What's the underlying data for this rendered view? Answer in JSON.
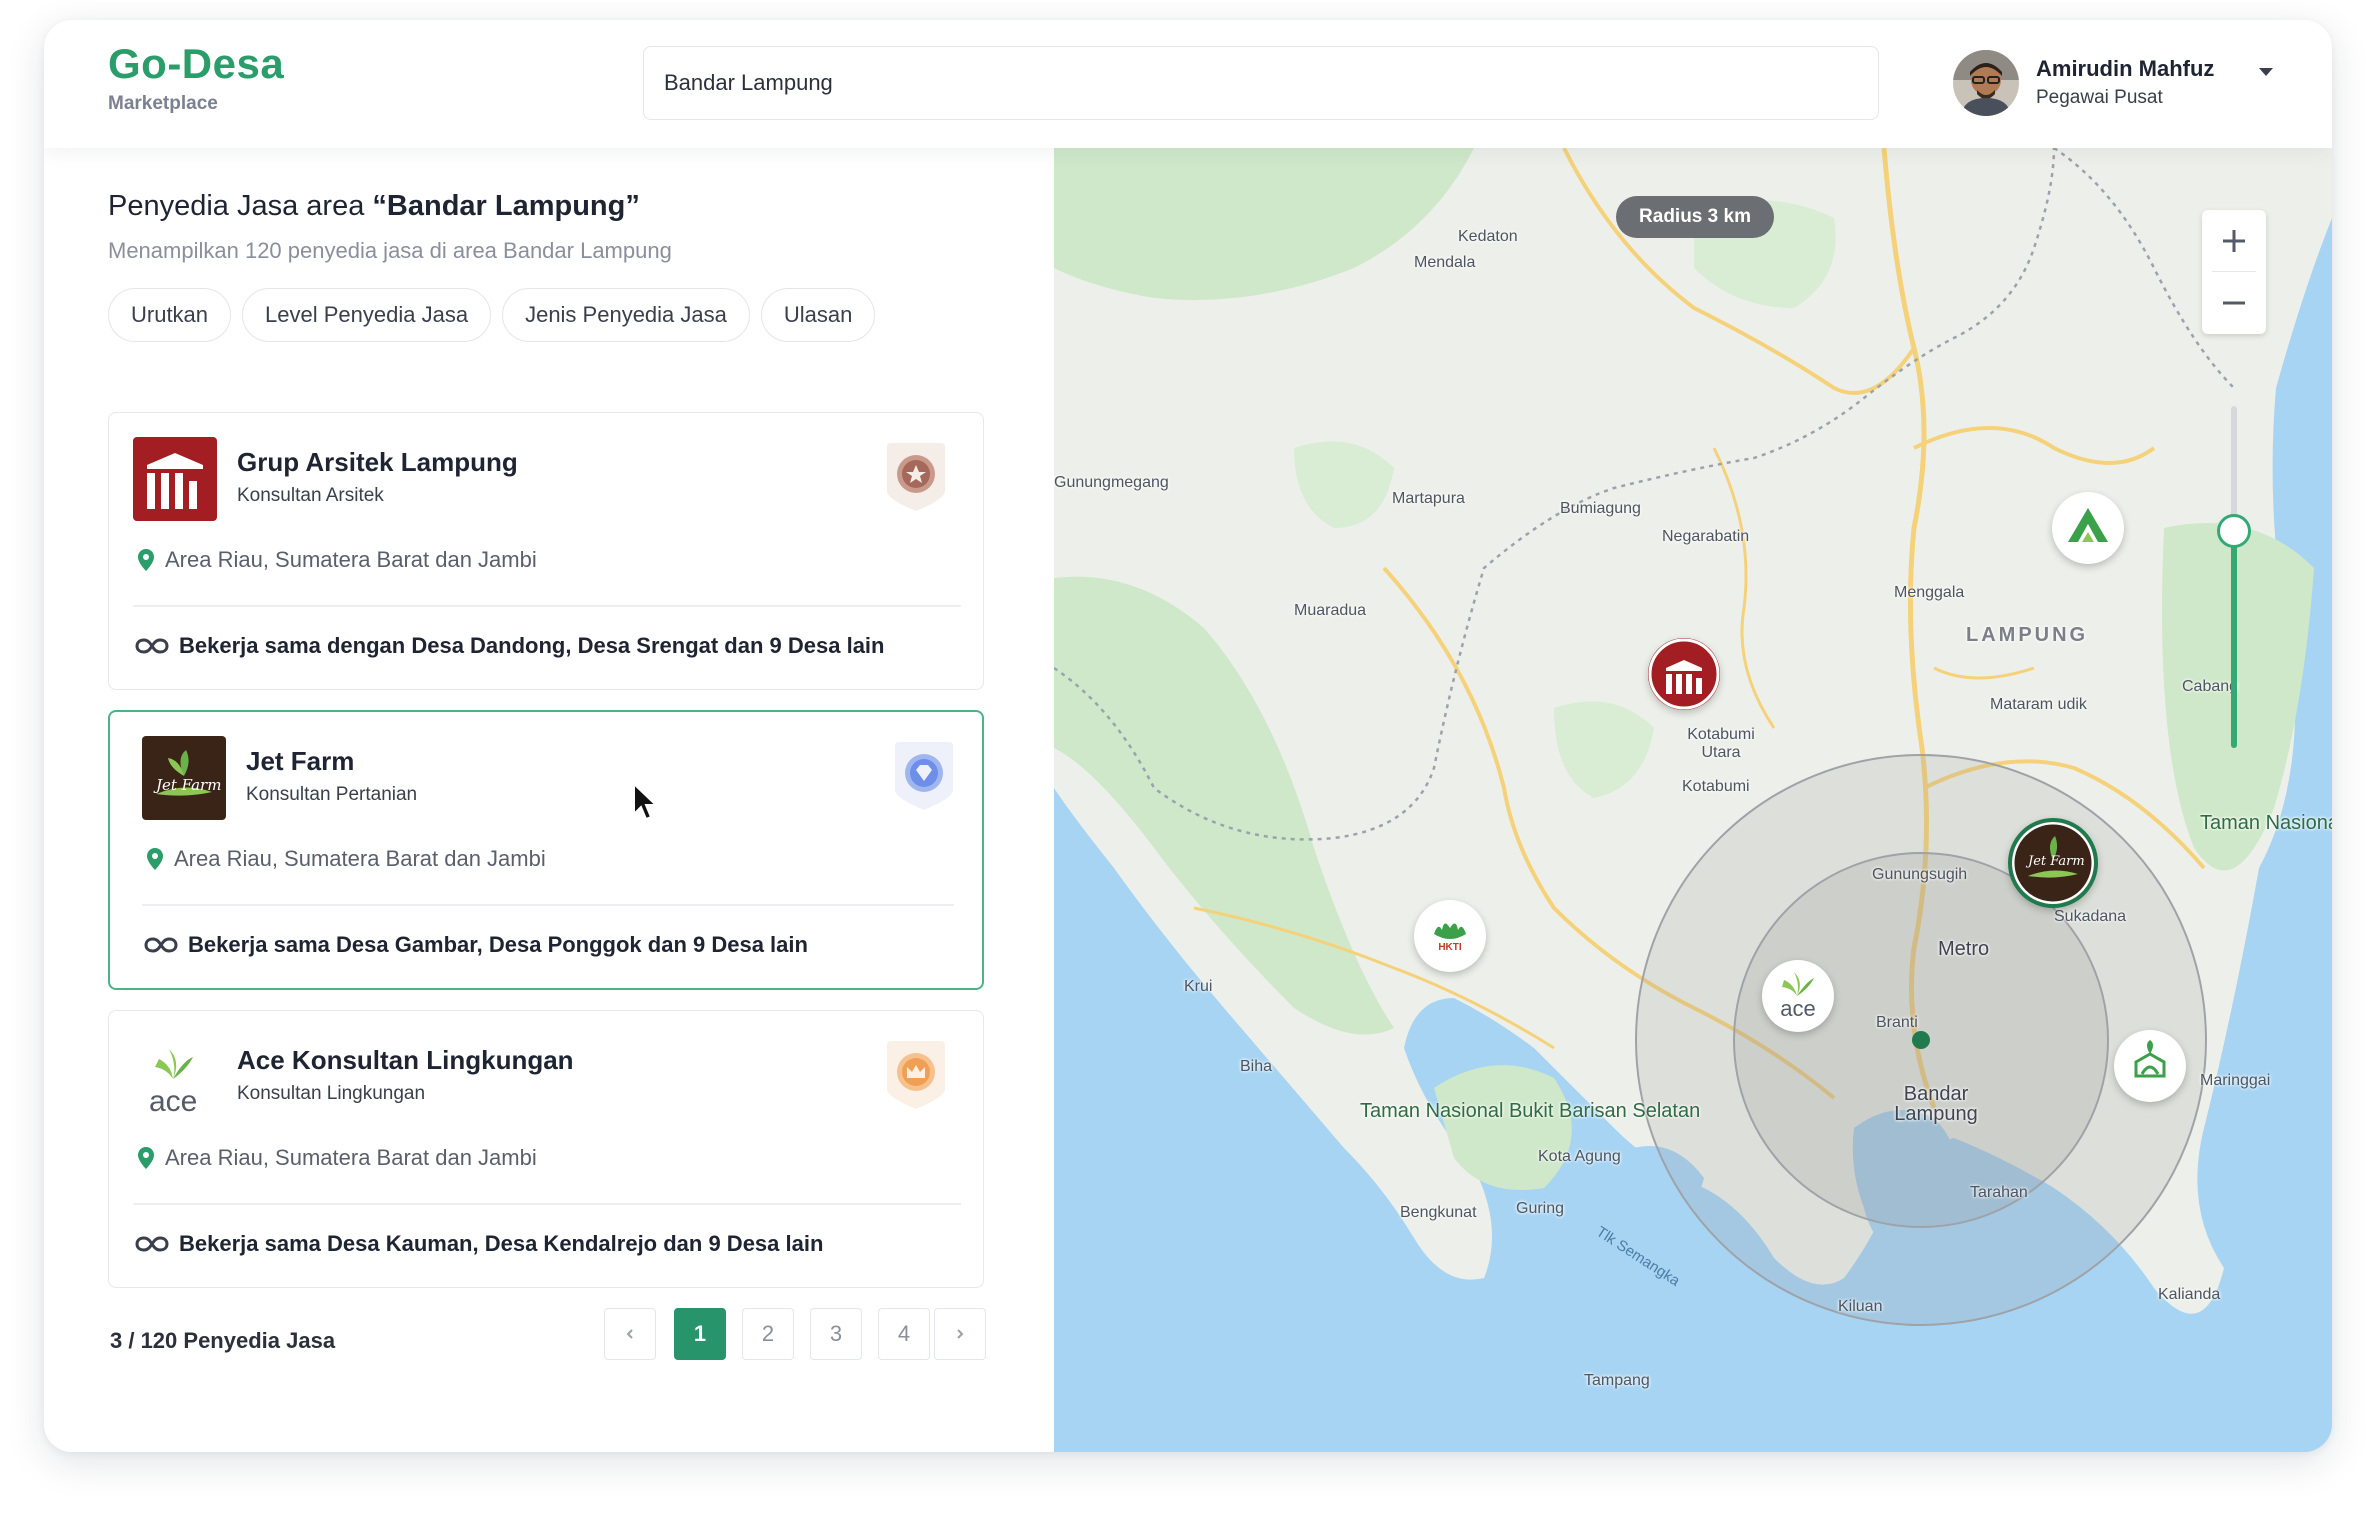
{
  "header": {
    "brand_title": "Go-Desa",
    "brand_subtitle": "Marketplace",
    "search_value": "Bandar Lampung",
    "user_name": "Amirudin Mahfuz",
    "user_role": "Pegawai Pusat",
    "avatar_icon": "user-photo-avatar",
    "caret_icon": "caret-down-icon"
  },
  "listing": {
    "title_prefix": "Penyedia Jasa area ",
    "title_area": "“Bandar Lampung”",
    "subtitle": "Menampilkan 120 penyedia jasa di area Bandar Lampung",
    "filters": [
      "Urutkan",
      "Level Penyedia Jasa",
      "Jenis Penyedia Jasa",
      "Ulasan"
    ]
  },
  "providers": [
    {
      "name": "Grup Arsitek Lampung",
      "type": "Konsultan Arsitek",
      "location": "Area Riau, Sumatera Barat dan Jambi",
      "collab": "Bekerja sama dengan Desa Dandong, Desa Srengat dan 9 Desa lain",
      "badge": "bronze-star-badge",
      "badge_color": "#a5685a"
    },
    {
      "name": "Jet Farm",
      "type": "Konsultan Pertanian",
      "location": "Area Riau, Sumatera Barat dan Jambi",
      "collab": "Bekerja sama Desa Gambar, Desa Ponggok dan 9 Desa lain",
      "badge": "diamond-badge",
      "badge_color": "#6d8fe8",
      "logo_text": "Jet Farm"
    },
    {
      "name": "Ace Konsultan Lingkungan",
      "type": "Konsultan Lingkungan",
      "location": "Area Riau, Sumatera Barat dan Jambi",
      "collab": "Bekerja sama Desa Kauman, Desa Kendalrejo dan 9 Desa lain",
      "badge": "gold-crown-badge",
      "badge_color": "#f0a055",
      "logo_text": "ace"
    }
  ],
  "pagination": {
    "summary": "3 / 120 Penyedia Jasa",
    "prev_icon": "chevron-left-icon",
    "next_icon": "chevron-right-icon",
    "pages": [
      "1",
      "2",
      "3",
      "4"
    ],
    "current": "1"
  },
  "map": {
    "radius_label": "Radius 3 km",
    "zoom_in_icon": "plus-icon",
    "zoom_out_icon": "minus-icon",
    "radius_slider_level": 0.63,
    "region_label": "LAMPUNG",
    "places": [
      "Kedaton",
      "Mendala",
      "Gunungmegang",
      "Martapura",
      "Bumiagung",
      "Negarabatin",
      "Menggala",
      "Muaradua",
      "Mataram udik",
      "Cabang",
      "Kotabumi Utara",
      "Kotabumi",
      "Gunungsugih",
      "Sukadana",
      "Metro",
      "Branti",
      "Bandar Lampung",
      "Krui",
      "Biha",
      "Kota Agung",
      "Bengkunat",
      "Guring",
      "Tarahan",
      "Maringgai",
      "Kalianda",
      "Kiluan",
      "Tampang"
    ],
    "parks": [
      "Taman Nasional Bukit Barisan Selatan",
      "Taman Nasional Way Kambas"
    ],
    "sea_label": "Tlk Semangka",
    "hkti_label": "HKTI",
    "colors": {
      "brand": "#2a9d6a",
      "accent": "#27946b",
      "water": "#a8d4f3",
      "land": "#edf0ea",
      "forest": "#cfe8c9"
    }
  }
}
